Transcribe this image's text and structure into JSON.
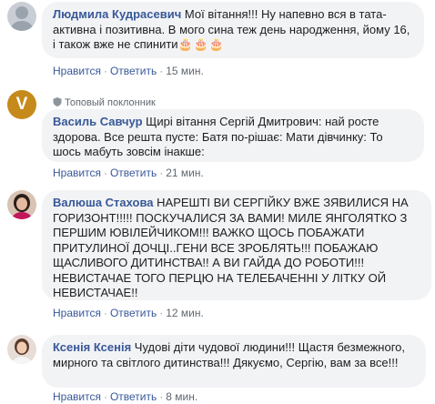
{
  "comments": [
    {
      "author": "Людмила Кудрасевич",
      "text": " Мої вітання!!! Ну напевно вся в тата-активна і позитивна. В мого сина теж день народження, йому 16, і також вже не спинити",
      "emoji": "🎂🎂🎂",
      "like_label": "Нравится",
      "reply_label": "Ответить",
      "time": "15 мин."
    },
    {
      "badge": "Топовый поклонник",
      "avatar_letter": "V",
      "author": "Василь Савчур",
      "text": " Щирі вітання Сергій Дмитрович: най росте здорова. Все решта пусте: Батя по-рішає: Мати дівчинку: То шось мабуть зовсім інакше:",
      "like_label": "Нравится",
      "reply_label": "Ответить",
      "time": "21 мин."
    },
    {
      "author": "Валюша Стахова",
      "text": " НАРЕШТІ ВИ СЕРГІЙКУ ВЖЕ ЗЯВИЛИСЯ НА ГОРИЗОНТ!!!!! ПОСКУЧАЛИСЯ ЗА ВАМИ! МИЛЕ ЯНГОЛЯТКО З ПЕРШИМ ЮВІЛЕЙЧИКОМ!!! ВАЖКО ЩОСЬ ПОБАЖАТИ ПРИТУЛИНОЇ ДОЧЦІ..ГЕНИ ВСЕ ЗРОБЛЯТЬ!!! ПОБАЖАЮ ЩАСЛИВОГО ДИТИНСТВА!! А ВИ ГАЙДА ДО РОБОТИ!!! НЕВИСТАЧАЕ ТОГО ПЕРЦЮ НА ТЕЛЕБАЧЕННІ У ЛІТКУ ОЙ НЕВИСТАЧАЕ!!",
      "like_label": "Нравится",
      "reply_label": "Ответить",
      "time": "12 мин."
    },
    {
      "author": "Ксенія Ксенія",
      "text": " Чудові діти чудової людини!!! Щастя безмежного, мирного та світлого дитинства!!! Дякуємо, Сергію, вам за все!!!",
      "like_label": "Нравится",
      "reply_label": "Ответить",
      "time": "8 мин."
    }
  ],
  "colors": {
    "author": "#385898",
    "bubble": "#f2f3f5",
    "meta": "#606770"
  }
}
